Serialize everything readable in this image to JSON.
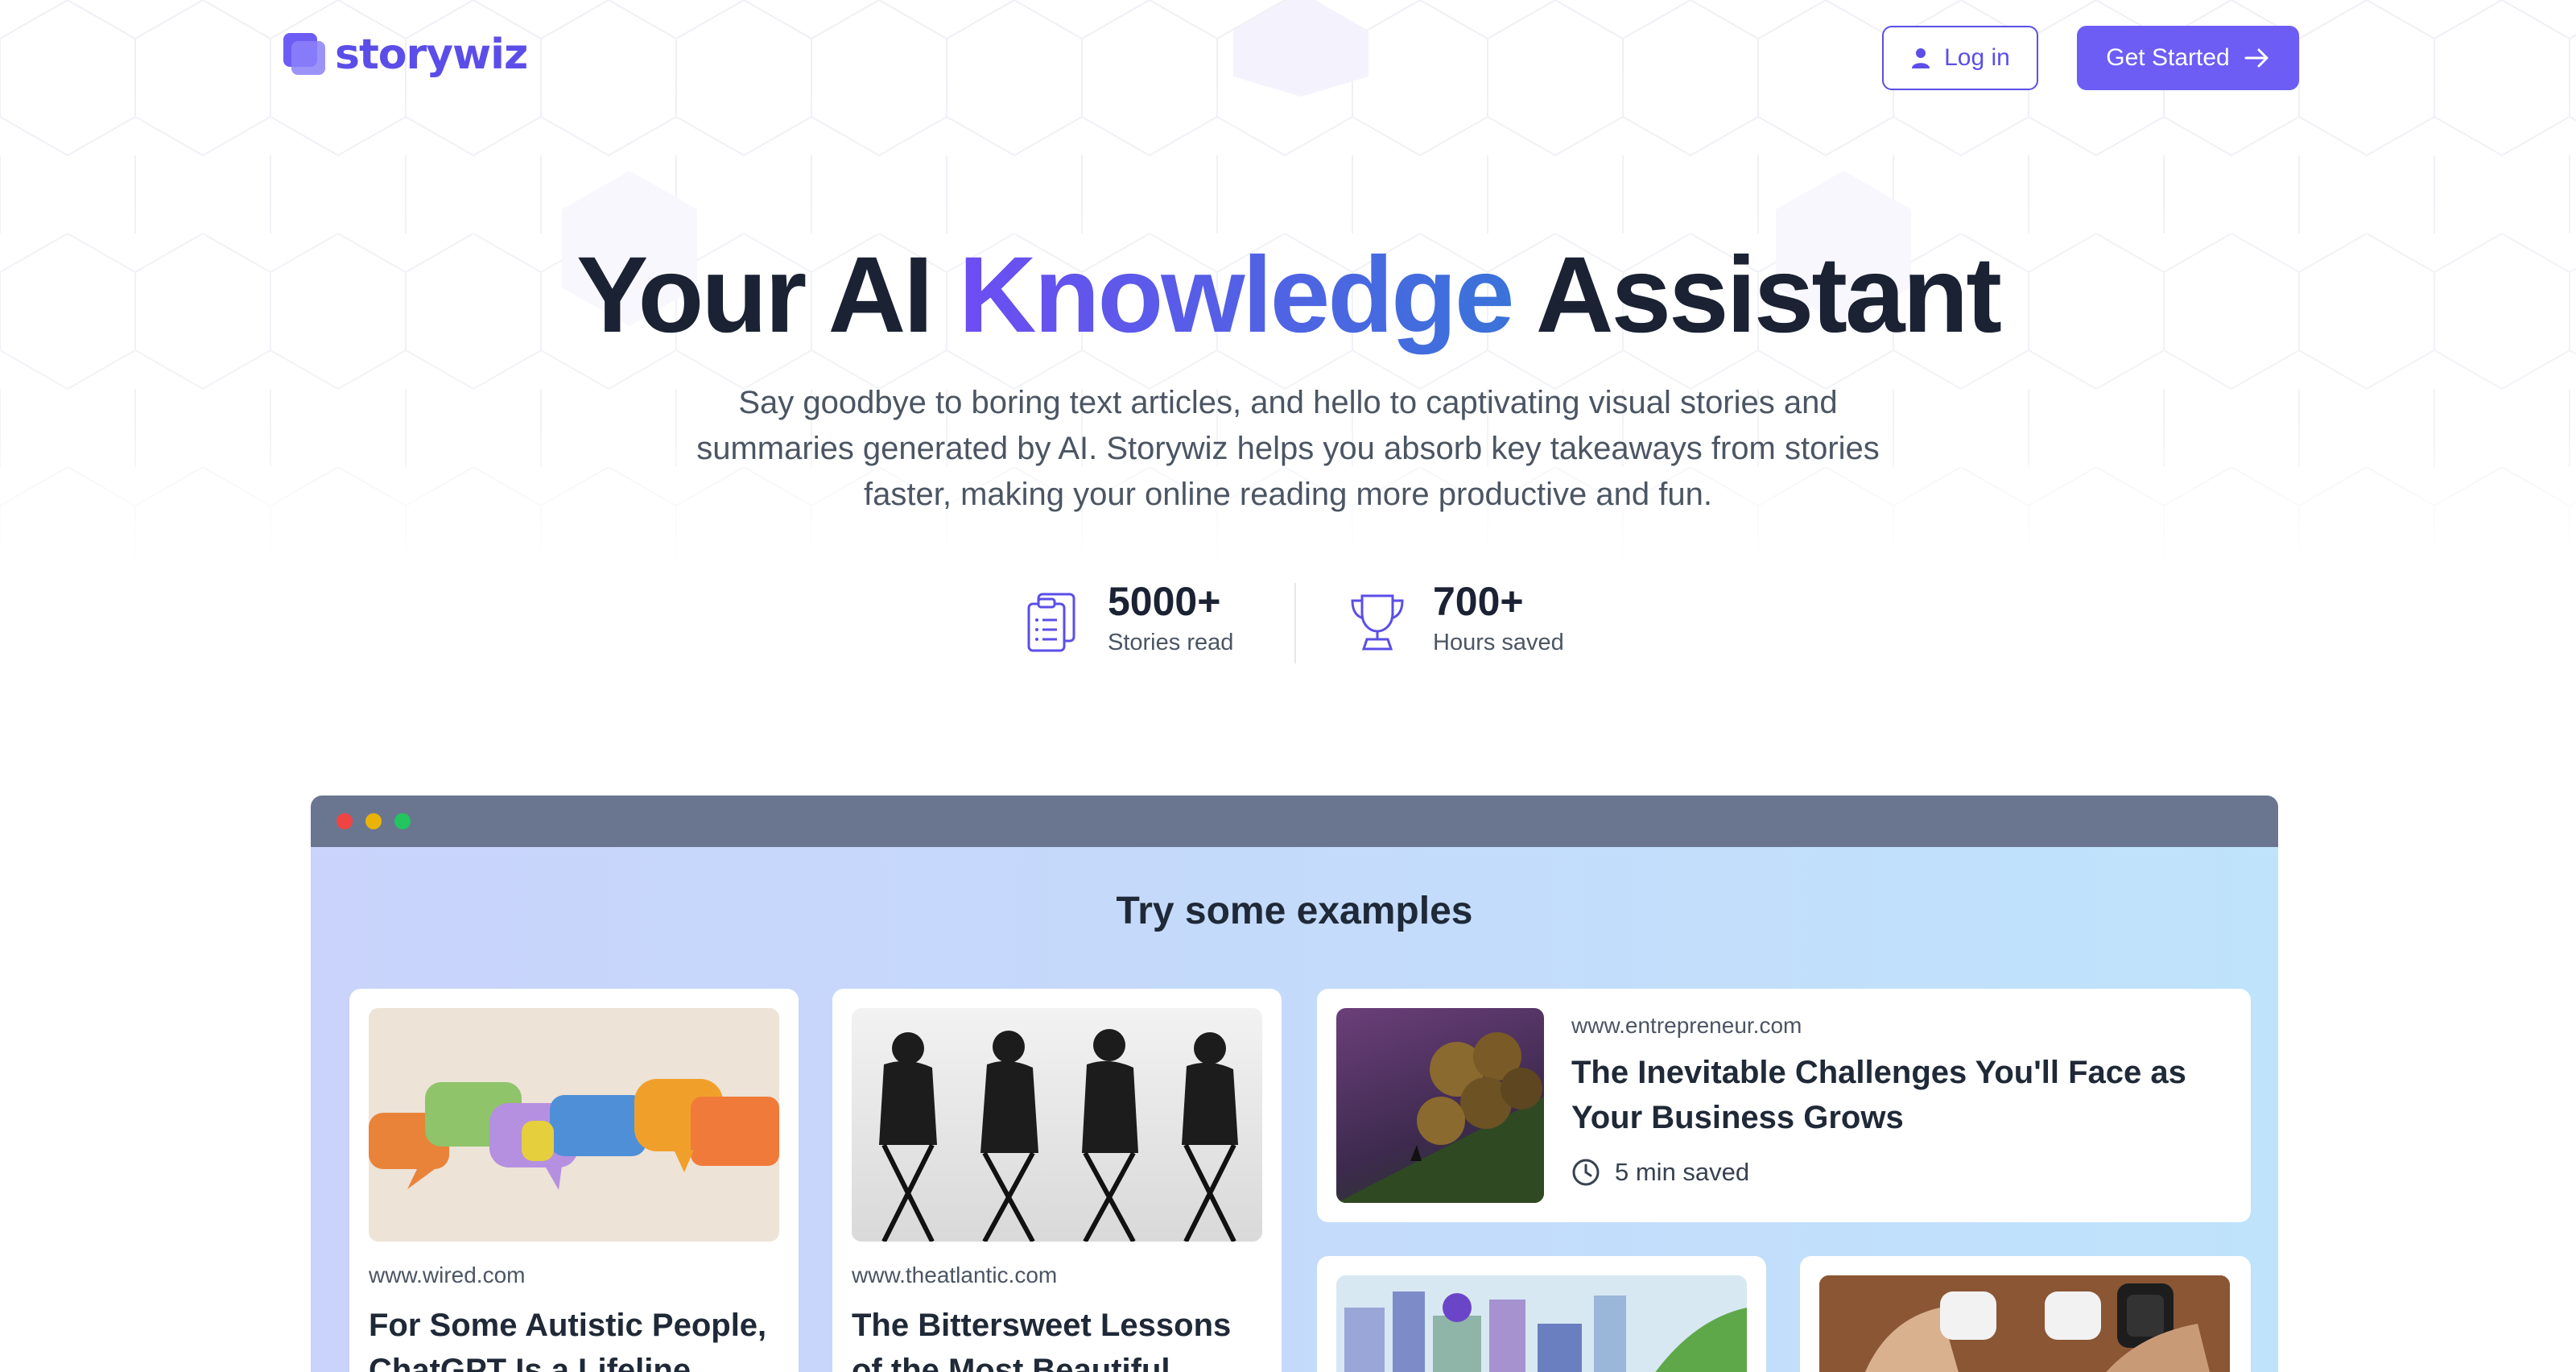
{
  "header": {
    "logo_text": "storywiz",
    "login_label": "Log in",
    "get_started_label": "Get Started"
  },
  "hero": {
    "title_part1": "Your AI",
    "title_accent": "Knowledge",
    "title_part2": "Assistant",
    "subtitle": "Say goodbye to boring text articles, and hello to captivating visual stories and summaries generated by AI. Storywiz helps you absorb key takeaways from stories faster, making your online reading more productive and fun."
  },
  "stats": [
    {
      "value": "5000+",
      "label": "Stories read",
      "icon": "clipboard-icon"
    },
    {
      "value": "700+",
      "label": "Hours saved",
      "icon": "trophy-icon"
    }
  ],
  "examples": {
    "title": "Try some examples",
    "cards": [
      {
        "site": "www.wired.com",
        "title": "For Some Autistic People, ChatGPT Is a Lifeline"
      },
      {
        "site": "www.theatlantic.com",
        "title": "The Bittersweet Lessons of the Most Beautiful"
      },
      {
        "site": "www.entrepreneur.com",
        "title": "The Inevitable Challenges You'll Face as Your Business Grows",
        "saved": "5 min saved"
      }
    ]
  },
  "colors": {
    "brand": "#6d5df5",
    "title": "#1a2233",
    "browser_bar": "#6a7690",
    "dot_red": "#ef4444",
    "dot_yellow": "#eab308",
    "dot_green": "#22c55e"
  }
}
